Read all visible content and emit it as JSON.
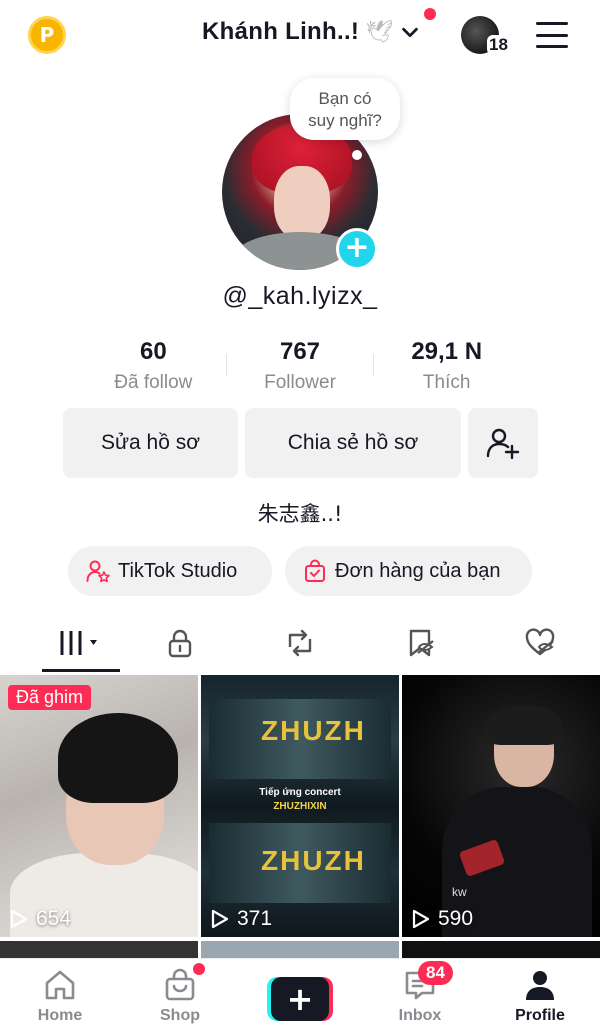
{
  "header": {
    "points_label": "P",
    "title": "Khánh Linh..!",
    "title_emoji": "🕊",
    "account_count": "18"
  },
  "profile": {
    "thought_line1": "Bạn có",
    "thought_line2": "suy nghĩ?",
    "handle": "@_kah.lyizx_",
    "stats": [
      {
        "value": "60",
        "label": "Đã follow"
      },
      {
        "value": "767",
        "label": "Follower"
      },
      {
        "value": "29,1 N",
        "label": "Thích"
      }
    ],
    "edit_label": "Sửa hồ sơ",
    "share_label": "Chia sẻ hồ sơ",
    "bio": "朱志鑫..!",
    "studio_label": "TikTok Studio",
    "orders_label": "Đơn hàng của bạn"
  },
  "videos": [
    {
      "badge": "Đã ghim",
      "views": "654"
    },
    {
      "views": "371",
      "screen_text": "ZHUZH",
      "concert_line1": "Tiếp ứng concert",
      "concert_line2": "ZHUZHIXIN"
    },
    {
      "views": "590",
      "overlay": "kw"
    }
  ],
  "nav": {
    "home": "Home",
    "shop": "Shop",
    "create": "+",
    "inbox": "Inbox",
    "inbox_badge": "84",
    "profile": "Profile"
  },
  "colors": {
    "accent_red": "#fe2c55",
    "accent_cyan": "#20d5ec",
    "text": "#161823",
    "muted": "#8a8b91",
    "button_bg": "#f1f1f2"
  }
}
